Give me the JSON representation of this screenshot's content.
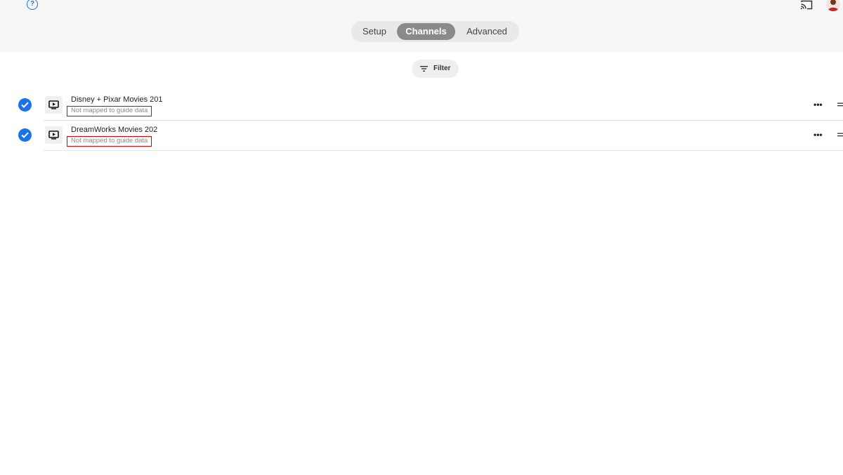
{
  "header": {
    "help_glyph": "?",
    "icons": [
      "help-icon",
      "cast-icon",
      "avatar"
    ],
    "tabs": [
      {
        "label": "Setup",
        "active": false
      },
      {
        "label": "Channels",
        "active": true
      },
      {
        "label": "Advanced",
        "active": false
      }
    ]
  },
  "toolbar": {
    "filter_label": "Filter",
    "filter_icon": "filter-icon"
  },
  "channels": [
    {
      "name": "Disney + Pixar Movies 201",
      "status": "Not mapped to guide data",
      "checked": true
    },
    {
      "name": "DreamWorks Movies 202",
      "status": "Not mapped to guide data",
      "checked": true
    }
  ],
  "row_actions": {
    "more_glyph": "•••",
    "more_icon": "more-horizontal-icon",
    "drag_icon": "drag-handle-icon"
  },
  "colors": {
    "accent": "#1a73e8",
    "active_tab": "#8a8a8a",
    "highlight_box": "#e00000",
    "header_bg": "#f7f7f7"
  }
}
